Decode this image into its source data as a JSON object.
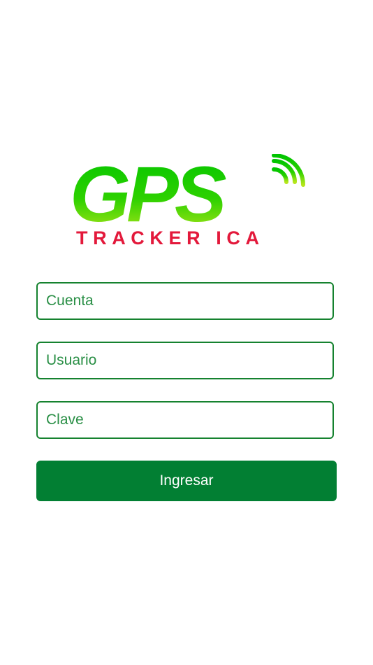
{
  "brand": {
    "logo_main": "GPS",
    "logo_sub": "TRACKER ICA",
    "colors": {
      "logo_green_top": "#00c400",
      "logo_green_bottom": "#a8e21a",
      "logo_red": "#e3193b"
    }
  },
  "form": {
    "account_placeholder": "Cuenta",
    "user_placeholder": "Usuario",
    "password_placeholder": "Clave",
    "submit_label": "Ingresar"
  },
  "colors": {
    "field_border": "#15822f",
    "button_bg": "#027f33",
    "placeholder_text": "#2a8f46"
  }
}
